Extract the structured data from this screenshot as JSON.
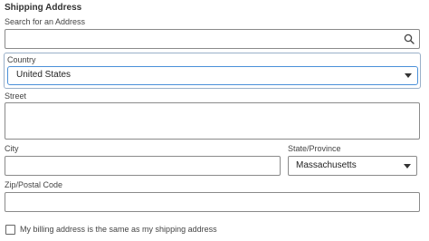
{
  "section": {
    "title": "Shipping Address"
  },
  "search": {
    "label": "Search for an Address",
    "value": "",
    "icon": "search-icon"
  },
  "country": {
    "label": "Country",
    "selected": "United States"
  },
  "street": {
    "label": "Street",
    "value": ""
  },
  "city": {
    "label": "City",
    "value": ""
  },
  "state": {
    "label": "State/Province",
    "selected": "Massachusetts"
  },
  "zip": {
    "label": "Zip/Postal Code",
    "value": ""
  },
  "billing": {
    "label": "My billing address is the same as my shipping address",
    "checked": false
  },
  "colors": {
    "focus": "#4a90d9",
    "border": "#8a8a8a"
  }
}
